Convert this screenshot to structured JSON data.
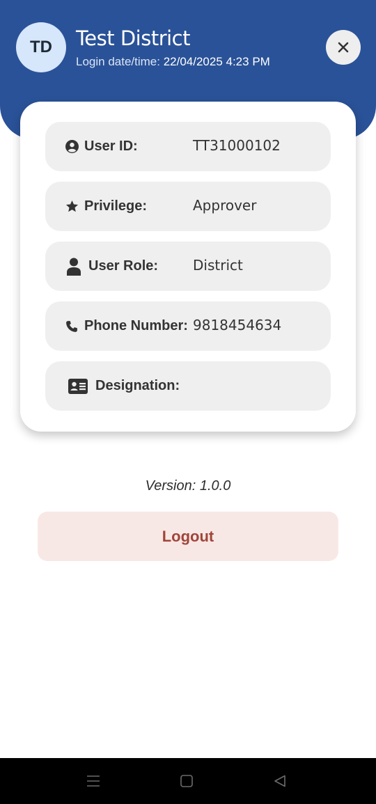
{
  "header": {
    "avatar_initials": "TD",
    "user_name": "Test District",
    "login_label": "Login date/time:",
    "login_value": "22/04/2025 4:23 PM",
    "close_icon": "close-icon",
    "background_color": "#2a5298"
  },
  "profile": {
    "rows": [
      {
        "icon": "user-circle-icon",
        "label": "User ID:",
        "value": "TT31000102"
      },
      {
        "icon": "star-icon",
        "label": "Privilege:",
        "value": "Approver"
      },
      {
        "icon": "person-icon",
        "label": "User Role:",
        "value": "District"
      },
      {
        "icon": "phone-icon",
        "label": "Phone Number:",
        "value": "9818454634"
      },
      {
        "icon": "id-card-icon",
        "label": "Designation:",
        "value": ""
      }
    ]
  },
  "footer": {
    "version": "Version: 1.0.0",
    "logout_label": "Logout",
    "logout_color": "#a0453a"
  },
  "system_nav": {
    "recents_icon": "menu-lines-icon",
    "home_icon": "square-icon",
    "back_icon": "triangle-back-icon"
  }
}
